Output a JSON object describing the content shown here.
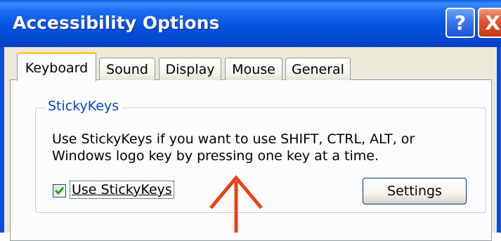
{
  "window": {
    "title": "Accessibility Options",
    "help_label": "?",
    "close_label": "X"
  },
  "tabs": [
    {
      "label": "Keyboard",
      "active": true
    },
    {
      "label": "Sound",
      "active": false
    },
    {
      "label": "Display",
      "active": false
    },
    {
      "label": "Mouse",
      "active": false
    },
    {
      "label": "General",
      "active": false
    }
  ],
  "stickykeys": {
    "group_title": "StickyKeys",
    "description_line1": "Use StickyKeys if you want to use SHIFT, CTRL, ALT, or",
    "description_line2": "Windows logo key by pressing one key at a time.",
    "checkbox_label": "Use StickyKeys",
    "checkbox_checked": true,
    "settings_label": "Settings"
  },
  "annotation": {
    "arrow_color": "#e8431a"
  },
  "colors": {
    "titlebar": "#0553e0",
    "group_label": "#0046d5",
    "active_tab_accent": "#ffc83c"
  }
}
